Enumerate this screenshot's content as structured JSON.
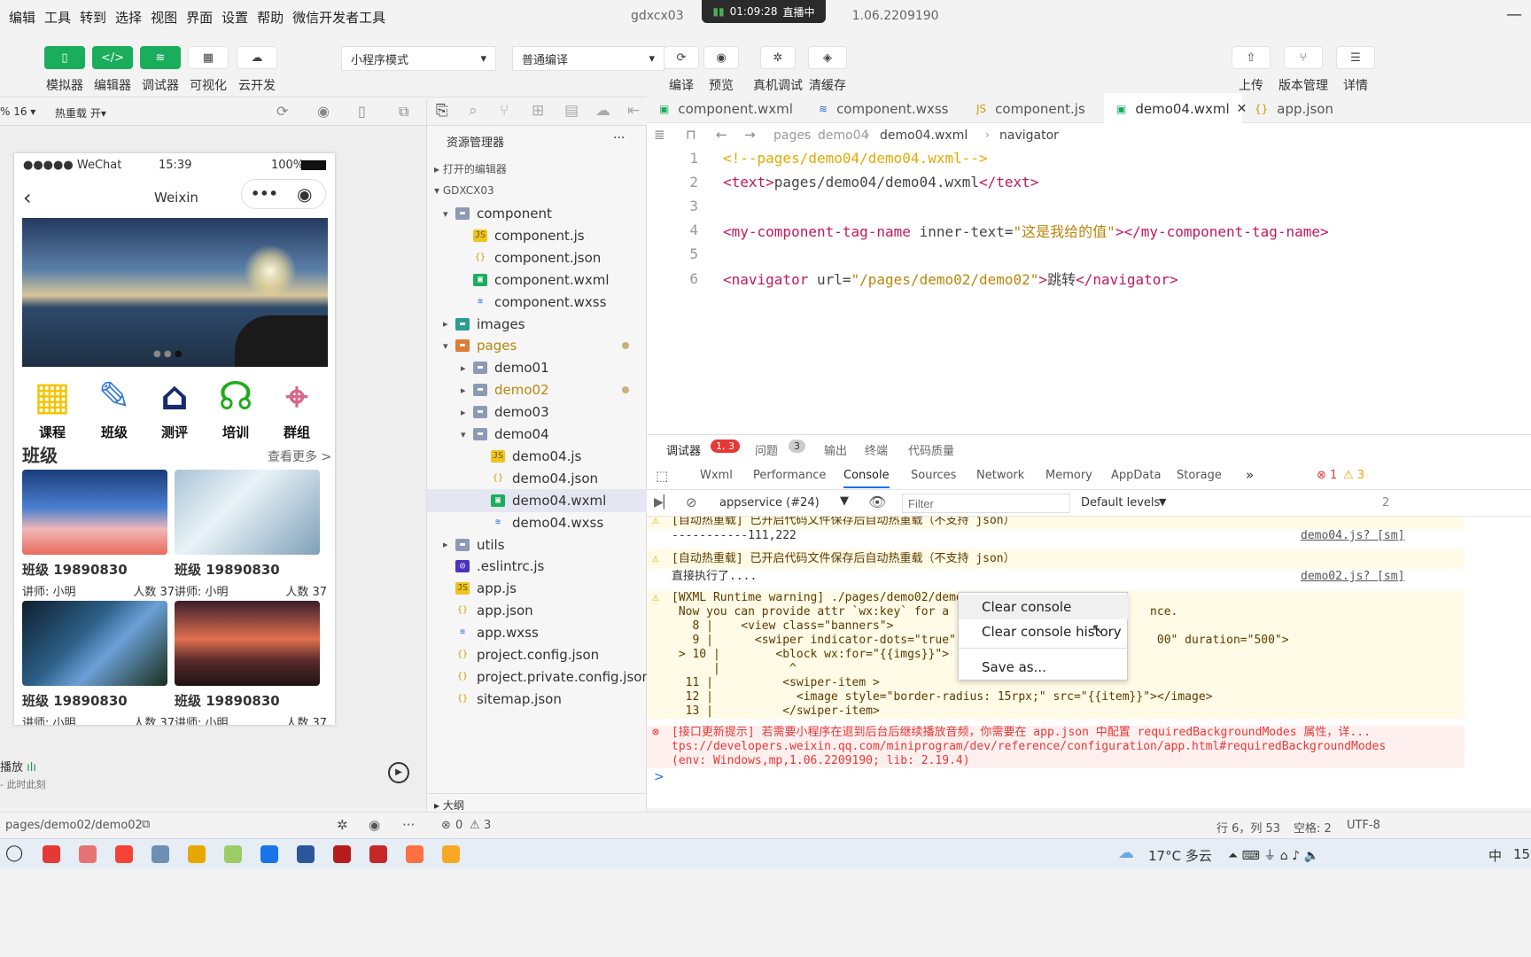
{
  "menu": [
    "编辑",
    "工具",
    "转到",
    "选择",
    "视图",
    "界面",
    "设置",
    "帮助",
    "微信开发者工具"
  ],
  "window_title": "gdxcx03",
  "window_version": "1.06.2209190",
  "live": {
    "time": "01:09:28",
    "status": "直播中"
  },
  "toolbar": {
    "left_buttons": [
      {
        "label": "模拟器",
        "icon": "phone-icon"
      },
      {
        "label": "编辑器",
        "icon": "code-icon"
      },
      {
        "label": "调试器",
        "icon": "debug-icon"
      },
      {
        "label": "可视化",
        "icon": "layout-icon"
      },
      {
        "label": "云开发",
        "icon": "cloud-icon"
      }
    ],
    "mode_select": "小程序模式",
    "compile_select": "普通编译",
    "mid_buttons": [
      {
        "label": "编译",
        "icon": "refresh-icon"
      },
      {
        "label": "预览",
        "icon": "eye-icon"
      },
      {
        "label": "真机调试",
        "icon": "bug-icon"
      },
      {
        "label": "清缓存",
        "icon": "layers-icon"
      }
    ],
    "right_buttons": [
      {
        "label": "上传",
        "icon": "upload-icon"
      },
      {
        "label": "版本管理",
        "icon": "branch-icon"
      },
      {
        "label": "详情",
        "icon": "menu-icon"
      }
    ]
  },
  "simulator_bar": {
    "zoom": "% 16 ▾",
    "hot_reload": "热重载 开▾"
  },
  "phone": {
    "carrier": "●●●●● WeChat",
    "time": "15:39",
    "battery": "100%",
    "nav_title": "Weixin",
    "icons": [
      {
        "label": "课程",
        "icon": "building-icon"
      },
      {
        "label": "班级",
        "icon": "edit-icon"
      },
      {
        "label": "测评",
        "icon": "house-icon"
      },
      {
        "label": "培训",
        "icon": "headset-icon"
      },
      {
        "label": "群组",
        "icon": "map-icon"
      }
    ],
    "section_title": "班级",
    "more": "查看更多 >",
    "cards": [
      {
        "title": "班级 19890830",
        "teacher": "讲师: 小明",
        "count": "人数 37"
      },
      {
        "title": "班级 19890830",
        "teacher": "讲师: 小明",
        "count": "人数 37"
      },
      {
        "title": "班级 19890830",
        "teacher": "讲师: 小明",
        "count": "人数 37"
      },
      {
        "title": "班级 19890830",
        "teacher": "讲师: 小明",
        "count": "人数 37"
      }
    ]
  },
  "player": {
    "label": "播放",
    "sub": "- 此时此刻"
  },
  "explorer": {
    "title": "资源管理器",
    "open_editors": "打开的编辑器",
    "project": "GDXCX03",
    "outline": "大纲",
    "rows": [
      {
        "label": "component",
        "kind": "folder",
        "depth": 1,
        "open": true
      },
      {
        "label": "component.js",
        "kind": "js",
        "depth": 2
      },
      {
        "label": "component.json",
        "kind": "json",
        "depth": 2
      },
      {
        "label": "component.wxml",
        "kind": "wxml",
        "depth": 2
      },
      {
        "label": "component.wxss",
        "kind": "wxss",
        "depth": 2
      },
      {
        "label": "images",
        "kind": "folder-img",
        "depth": 1,
        "open": false
      },
      {
        "label": "pages",
        "kind": "folder-pages",
        "depth": 1,
        "open": true,
        "modified": true
      },
      {
        "label": "demo01",
        "kind": "folder",
        "depth": 2,
        "open": false
      },
      {
        "label": "demo02",
        "kind": "folder",
        "depth": 2,
        "open": false,
        "modified": true
      },
      {
        "label": "demo03",
        "kind": "folder",
        "depth": 2,
        "open": false
      },
      {
        "label": "demo04",
        "kind": "folder",
        "depth": 2,
        "open": true
      },
      {
        "label": "demo04.js",
        "kind": "js",
        "depth": 3
      },
      {
        "label": "demo04.json",
        "kind": "json",
        "depth": 3
      },
      {
        "label": "demo04.wxml",
        "kind": "wxml",
        "depth": 3,
        "selected": true
      },
      {
        "label": "demo04.wxss",
        "kind": "wxss",
        "depth": 3
      },
      {
        "label": "utils",
        "kind": "folder",
        "depth": 1,
        "open": false
      },
      {
        "label": ".eslintrc.js",
        "kind": "eslint",
        "depth": 1
      },
      {
        "label": "app.js",
        "kind": "js",
        "depth": 1
      },
      {
        "label": "app.json",
        "kind": "json",
        "depth": 1
      },
      {
        "label": "app.wxss",
        "kind": "wxss",
        "depth": 1
      },
      {
        "label": "project.config.json",
        "kind": "json",
        "depth": 1
      },
      {
        "label": "project.private.config.json",
        "kind": "json",
        "depth": 1
      },
      {
        "label": "sitemap.json",
        "kind": "json",
        "depth": 1
      }
    ]
  },
  "editor": {
    "tabs": [
      "component.wxml",
      "component.wxss",
      "component.js",
      "demo04.wxml",
      "app.json"
    ],
    "active_tab": "demo04.wxml",
    "breadcrumb": [
      "pages",
      "demo04",
      "demo04.wxml",
      "navigator"
    ],
    "lines": [
      {
        "n": "1",
        "segs": [
          [
            "cm",
            "<!--pages/demo04/demo04.wxml-->"
          ]
        ]
      },
      {
        "n": "2",
        "segs": [
          [
            "tag",
            "<text>"
          ],
          [
            "attr",
            "pages/demo04/demo04.wxml"
          ],
          [
            "tag",
            "</text>"
          ]
        ]
      },
      {
        "n": "3",
        "segs": []
      },
      {
        "n": "4",
        "segs": [
          [
            "tag",
            "<my-component-tag-name "
          ],
          [
            "attr",
            "inner-text="
          ],
          [
            "str",
            "\"这是我给的值\""
          ],
          [
            "tag",
            "></my-component-tag-name>"
          ]
        ]
      },
      {
        "n": "5",
        "segs": []
      },
      {
        "n": "6",
        "segs": [
          [
            "tag",
            "<navigator "
          ],
          [
            "attr",
            "url="
          ],
          [
            "str",
            "\"/pages/demo02/demo02\""
          ],
          [
            "tag",
            ">"
          ],
          [
            "attr",
            "跳转"
          ],
          [
            "tag",
            "</navigator>"
          ]
        ]
      }
    ]
  },
  "panel": {
    "tabs": [
      "调试器",
      "问题",
      "输出",
      "终端",
      "代码质量"
    ],
    "debugger_badge": "1, 3",
    "problems_badge": "3",
    "devtabs": [
      "Wxml",
      "Performance",
      "Console",
      "Sources",
      "Network",
      "Memory",
      "AppData",
      "Storage"
    ],
    "active_devtab": "Console",
    "error_count": "1",
    "warn_count": "3",
    "context": "appservice (#24)",
    "filter_placeholder": "Filter",
    "levels": "Default levels",
    "side_count": "2"
  },
  "console": {
    "lines": [
      {
        "kind": "warn",
        "text": "[自动热重载] 已开启代码文件保存后自动热重载（不支持 json）",
        "src": ""
      },
      {
        "kind": "log",
        "text": "-----------111,222",
        "src": "demo04.js? [sm]"
      },
      {
        "kind": "warn",
        "text": "[自动热重载] 已开启代码文件保存后自动热重载（不支持 json）",
        "src": ""
      },
      {
        "kind": "log",
        "text": "直接执行了....",
        "src": "demo02.js? [sm]"
      },
      {
        "kind": "warn",
        "text": "[WXML Runtime warning] ./pages/demo02/demo0",
        "src": ""
      },
      {
        "kind": "warnc",
        "text": " Now you can provide attr `wx:key` for a `w                          nce.",
        "src": ""
      },
      {
        "kind": "warnc",
        "text": "   8 |    <view class=\"banners\">",
        "src": ""
      },
      {
        "kind": "warnc",
        "text": "   9 |      <swiper indicator-dots=\"true\" au                          00\" duration=\"500\">",
        "src": ""
      },
      {
        "kind": "warnc",
        "text": " > 10 |        <block wx:for=\"{{imgs}}\">",
        "src": ""
      },
      {
        "kind": "warnc",
        "text": "      |          ^",
        "src": ""
      },
      {
        "kind": "warnc",
        "text": "  11 |          <swiper-item >",
        "src": ""
      },
      {
        "kind": "warnc",
        "text": "  12 |            <image style=\"border-radius: 15rpx;\" src=\"{{item}}\"></image>",
        "src": ""
      },
      {
        "kind": "warnc",
        "text": "  13 |          </swiper-item>",
        "src": ""
      },
      {
        "kind": "error",
        "text": "[接口更新提示] 若需要小程序在退到后台后继续播放音频，你需要在 app.json 中配置 requiredBackgroundModes 属性，详...",
        "src": ""
      },
      {
        "kind": "errorc",
        "text": "tps://developers.weixin.qq.com/miniprogram/dev/reference/configuration/app.html#requiredBackgroundModes",
        "src": ""
      },
      {
        "kind": "errorc",
        "text": "(env: Windows,mp,1.06.2209190; lib: 2.19.4)",
        "src": ""
      }
    ],
    "prompt": ">"
  },
  "context_menu": [
    "Clear console",
    "Clear console history",
    "Save as..."
  ],
  "status": {
    "path": "pages/demo02/demo02",
    "errors": "0",
    "warnings": "3",
    "position": "行 6，列 53",
    "spaces": "空格: 2",
    "encoding": "UTF-8"
  },
  "taskbar": {
    "weather": "17°C 多云",
    "ime": "中",
    "clock": "15"
  }
}
